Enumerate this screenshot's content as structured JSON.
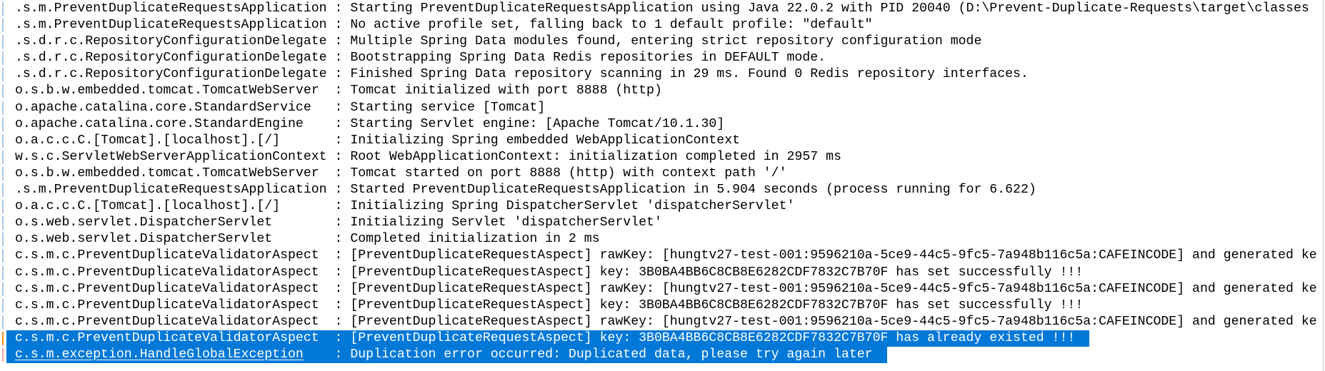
{
  "colors": {
    "selection": "#0078d7",
    "text": "#000000",
    "gutter": "#a9c8e6"
  },
  "separator": " : ",
  "lines": [
    {
      "logger": ".s.m.PreventDuplicateRequestsApplication",
      "message": "Starting PreventDuplicateRequestsApplication using Java 22.0.2 with PID 20040 (D:\\Prevent-Duplicate-Requests\\target\\classes"
    },
    {
      "logger": ".s.m.PreventDuplicateRequestsApplication",
      "message": "No active profile set, falling back to 1 default profile: \"default\""
    },
    {
      "logger": ".s.d.r.c.RepositoryConfigurationDelegate",
      "message": "Multiple Spring Data modules found, entering strict repository configuration mode"
    },
    {
      "logger": ".s.d.r.c.RepositoryConfigurationDelegate",
      "message": "Bootstrapping Spring Data Redis repositories in DEFAULT mode."
    },
    {
      "logger": ".s.d.r.c.RepositoryConfigurationDelegate",
      "message": "Finished Spring Data repository scanning in 29 ms. Found 0 Redis repository interfaces."
    },
    {
      "logger": "o.s.b.w.embedded.tomcat.TomcatWebServer",
      "message": "Tomcat initialized with port 8888 (http)"
    },
    {
      "logger": "o.apache.catalina.core.StandardService",
      "message": "Starting service [Tomcat]"
    },
    {
      "logger": "o.apache.catalina.core.StandardEngine",
      "message": "Starting Servlet engine: [Apache Tomcat/10.1.30]"
    },
    {
      "logger": "o.a.c.c.C.[Tomcat].[localhost].[/]",
      "message": "Initializing Spring embedded WebApplicationContext"
    },
    {
      "logger": "w.s.c.ServletWebServerApplicationContext",
      "message": "Root WebApplicationContext: initialization completed in 2957 ms"
    },
    {
      "logger": "o.s.b.w.embedded.tomcat.TomcatWebServer",
      "message": "Tomcat started on port 8888 (http) with context path '/'"
    },
    {
      "logger": ".s.m.PreventDuplicateRequestsApplication",
      "message": "Started PreventDuplicateRequestsApplication in 5.904 seconds (process running for 6.622)"
    },
    {
      "logger": "o.a.c.c.C.[Tomcat].[localhost].[/]",
      "message": "Initializing Spring DispatcherServlet 'dispatcherServlet'"
    },
    {
      "logger": "o.s.web.servlet.DispatcherServlet",
      "message": "Initializing Servlet 'dispatcherServlet'"
    },
    {
      "logger": "o.s.web.servlet.DispatcherServlet",
      "message": "Completed initialization in 2 ms"
    },
    {
      "logger": "c.s.m.c.PreventDuplicateValidatorAspect",
      "message": "[PreventDuplicateRequestAspect] rawKey: [hungtv27-test-001:9596210a-5ce9-44c5-9fc5-7a948b116c5a:CAFEINCODE] and generated ke"
    },
    {
      "logger": "c.s.m.c.PreventDuplicateValidatorAspect",
      "message": "[PreventDuplicateRequestAspect] key: 3B0BA4BB6C8CB8E6282CDF7832C7B70F has set successfully !!!"
    },
    {
      "logger": "c.s.m.c.PreventDuplicateValidatorAspect",
      "message": "[PreventDuplicateRequestAspect] rawKey: [hungtv27-test-001:9596210a-5ce9-44c5-9fc5-7a948b116c5a:CAFEINCODE] and generated ke"
    },
    {
      "logger": "c.s.m.c.PreventDuplicateValidatorAspect",
      "message": "[PreventDuplicateRequestAspect] key: 3B0BA4BB6C8CB8E6282CDF7832C7B70F has set successfully !!!"
    },
    {
      "logger": "c.s.m.c.PreventDuplicateValidatorAspect",
      "message": "[PreventDuplicateRequestAspect] rawKey: [hungtv27-test-001:9596210a-5ce9-44c5-9fc5-7a948b116c5a:CAFEINCODE] and generated ke"
    },
    {
      "logger": "c.s.m.c.PreventDuplicateValidatorAspect",
      "message": "[PreventDuplicateRequestAspect] key: 3B0BA4BB6C8CB8E6282CDF7832C7B70F has already existed !!!",
      "selected": true
    },
    {
      "logger": "c.s.m.exception.HandleGlobalException",
      "message": "Duplication error occurred: Duplicated data, please try again later",
      "selected": true,
      "link": true
    }
  ]
}
